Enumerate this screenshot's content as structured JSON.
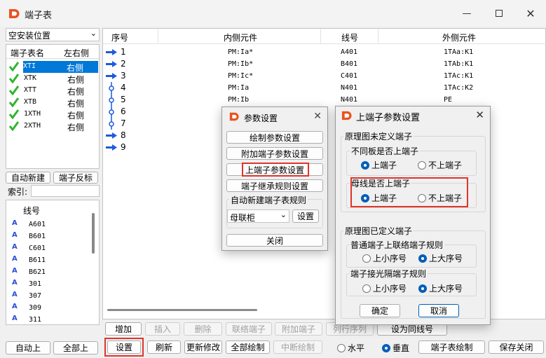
{
  "window": {
    "title": "端子表",
    "minimize_icon": "minimize-icon",
    "maximize_icon": "maximize-icon",
    "close_icon": "close-icon"
  },
  "left": {
    "location_select": "空安装位置",
    "list_headers": {
      "name": "端子表名",
      "side": "左右侧"
    },
    "terminal_lists": [
      {
        "name": "XTI",
        "side": "右侧",
        "selected": true
      },
      {
        "name": "XTK",
        "side": "右侧"
      },
      {
        "name": "XTT",
        "side": "右侧"
      },
      {
        "name": "XTB",
        "side": "右侧"
      },
      {
        "name": "1XTH",
        "side": "右侧"
      },
      {
        "name": "2XTH",
        "side": "右侧"
      }
    ],
    "auto_new": "自动新建",
    "reverse": "端子反标",
    "index_label": "索引:",
    "wire_header": "线号",
    "wires": [
      "A601",
      "B601",
      "C601",
      "B611",
      "B621",
      "301",
      "307",
      "309",
      "311"
    ],
    "auto_up": "自动上",
    "all_up": "全部上"
  },
  "table": {
    "headers": {
      "seq": "序号",
      "inner": "内侧元件",
      "wire": "线号",
      "outer": "外侧元件"
    },
    "rows": [
      {
        "seq": "1",
        "inner": "PM:Ia*",
        "wire": "A401",
        "outer": "1TAa:K1",
        "icon": "arrow"
      },
      {
        "seq": "2",
        "inner": "PM:Ib*",
        "wire": "B401",
        "outer": "1TAb:K1",
        "icon": "arrow"
      },
      {
        "seq": "3",
        "inner": "PM:Ic*",
        "wire": "C401",
        "outer": "1TAc:K1",
        "icon": "arrow"
      },
      {
        "seq": "4",
        "inner": "PM:Ia",
        "wire": "N401",
        "outer": "1TAc:K2",
        "icon": "link"
      },
      {
        "seq": "5",
        "inner": "PM:Ib",
        "wire": "N401",
        "outer": "PE",
        "icon": "link"
      },
      {
        "seq": "6",
        "inner": "",
        "wire": "",
        "outer": "",
        "icon": "link"
      },
      {
        "seq": "7",
        "inner": "",
        "wire": "",
        "outer": "",
        "icon": "link"
      },
      {
        "seq": "8",
        "inner": "",
        "wire": "",
        "outer": "",
        "icon": "arrow"
      },
      {
        "seq": "9",
        "inner": "",
        "wire": "",
        "outer": "",
        "icon": "arrow"
      }
    ]
  },
  "toolbar": {
    "add": "增加",
    "insert": "插入",
    "delete": "删除",
    "link": "联络端子",
    "attach": "附加端子",
    "hidden1": "列行序列",
    "hidden2": "设为同线号",
    "settings": "设置",
    "refresh": "刷新",
    "update": "更新修改",
    "draw_all": "全部绘制",
    "interrupt": "中断绘制",
    "horizontal": "水平",
    "vertical": "垂直",
    "draw_table": "端子表绘制",
    "save_close": "保存关闭"
  },
  "param_dialog": {
    "title": "参数设置",
    "draw_params": "绘制参数设置",
    "attach_params": "附加端子参数设置",
    "up_params": "上端子参数设置",
    "inherit_rules": "端子继承规则设置",
    "auto_rule_group": "自动新建端子表规则",
    "rule_select": "母联柜",
    "rule_settings": "设置",
    "close": "关闭"
  },
  "up_dialog": {
    "title": "上端子参数设置",
    "g1": "原理图未定义端子",
    "g1a": "不同板是否上端子",
    "g1a_opts": [
      "上端子",
      "不上端子"
    ],
    "g1b": "母线是否上端子",
    "g1b_opts": [
      "上端子",
      "不上端子"
    ],
    "g2": "原理图已定义端子",
    "g2a": "普通端子上联络端子规则",
    "g2a_opts": [
      "上小序号",
      "上大序号"
    ],
    "g2b": "端子接光隔端子规则",
    "g2b_opts": [
      "上小序号",
      "上大序号"
    ],
    "ok": "确定",
    "cancel": "取消"
  },
  "colors": {
    "accent": "#005fb8",
    "highlight": "#e0342a",
    "arrow": "#1e5adc",
    "check": "#2fb52f"
  }
}
